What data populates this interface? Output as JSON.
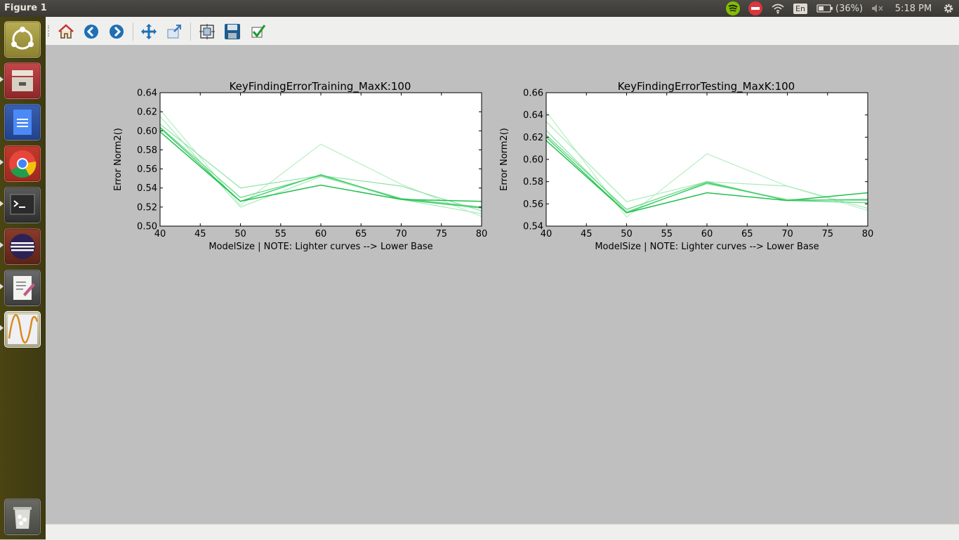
{
  "window": {
    "title": "Figure 1"
  },
  "panel": {
    "battery_text": "(36%)",
    "clock": "5:18 PM",
    "keyboard_layout": "En",
    "icons": [
      "spotify-icon",
      "no-entry-icon",
      "wifi-icon",
      "keyboard-layout-icon",
      "battery-icon",
      "volume-muted-icon",
      "gear-icon"
    ]
  },
  "launcher": {
    "items": [
      "ubuntu-dash-icon",
      "file-manager-icon",
      "docs-icon",
      "chrome-icon",
      "terminal-icon",
      "eclipse-icon",
      "text-editor-icon",
      "matplotlib-figure-icon",
      "trash-icon"
    ]
  },
  "toolbar": {
    "buttons": [
      "home-icon",
      "back-icon",
      "forward-icon",
      "pan-icon",
      "zoom-icon",
      "subplots-icon",
      "save-icon",
      "edit-check-icon"
    ]
  },
  "chart_data": [
    {
      "type": "line",
      "title": "KeyFindingErrorTraining_MaxK:100",
      "xlabel": "ModelSize | NOTE: Lighter curves --> Lower Base",
      "ylabel": "Error Norm2()",
      "x": [
        40,
        50,
        60,
        70,
        80
      ],
      "xlim": [
        40,
        80
      ],
      "ylim": [
        0.5,
        0.64
      ],
      "xticks": [
        "40",
        "45",
        "50",
        "55",
        "60",
        "65",
        "70",
        "75",
        "80"
      ],
      "yticks": [
        "0.50",
        "0.52",
        "0.54",
        "0.56",
        "0.58",
        "0.60",
        "0.62",
        "0.64"
      ],
      "grid": false,
      "series": [
        {
          "values": [
            0.622,
            0.522,
            0.586,
            0.544,
            0.51
          ],
          "color": "#b7efc4",
          "width": 1.2
        },
        {
          "values": [
            0.615,
            0.52,
            0.552,
            0.528,
            0.513
          ],
          "color": "#a6ecb8",
          "width": 1.2
        },
        {
          "values": [
            0.607,
            0.54,
            0.553,
            0.542,
            0.516
          ],
          "color": "#8ee4a4",
          "width": 1.2
        },
        {
          "values": [
            0.604,
            0.53,
            0.553,
            0.529,
            0.52
          ],
          "color": "#6ad98a",
          "width": 1.3
        },
        {
          "values": [
            0.603,
            0.526,
            0.554,
            0.528,
            0.519
          ],
          "color": "#44cc6c",
          "width": 1.4
        },
        {
          "values": [
            0.599,
            0.526,
            0.543,
            0.528,
            0.526
          ],
          "color": "#22c04f",
          "width": 1.5
        }
      ]
    },
    {
      "type": "line",
      "title": "KeyFindingErrorTesting_MaxK:100",
      "xlabel": "ModelSize | NOTE: Lighter curves --> Lower Base",
      "ylabel": "Error Norm2()",
      "x": [
        40,
        50,
        60,
        70,
        80
      ],
      "xlim": [
        40,
        80
      ],
      "ylim": [
        0.54,
        0.66
      ],
      "xticks": [
        "40",
        "45",
        "50",
        "55",
        "60",
        "65",
        "70",
        "75",
        "80"
      ],
      "yticks": [
        "0.54",
        "0.56",
        "0.58",
        "0.60",
        "0.62",
        "0.64",
        "0.66"
      ],
      "grid": false,
      "series": [
        {
          "values": [
            0.643,
            0.548,
            0.605,
            0.576,
            0.554
          ],
          "color": "#b7efc4",
          "width": 1.2
        },
        {
          "values": [
            0.634,
            0.562,
            0.58,
            0.576,
            0.556
          ],
          "color": "#a6ecb8",
          "width": 1.2
        },
        {
          "values": [
            0.626,
            0.553,
            0.578,
            0.564,
            0.563
          ],
          "color": "#8ee4a4",
          "width": 1.2
        },
        {
          "values": [
            0.622,
            0.555,
            0.58,
            0.563,
            0.561
          ],
          "color": "#6ad98a",
          "width": 1.3
        },
        {
          "values": [
            0.62,
            0.552,
            0.579,
            0.563,
            0.564
          ],
          "color": "#44cc6c",
          "width": 1.4
        },
        {
          "values": [
            0.617,
            0.552,
            0.57,
            0.563,
            0.57
          ],
          "color": "#22c04f",
          "width": 1.5
        }
      ]
    }
  ]
}
